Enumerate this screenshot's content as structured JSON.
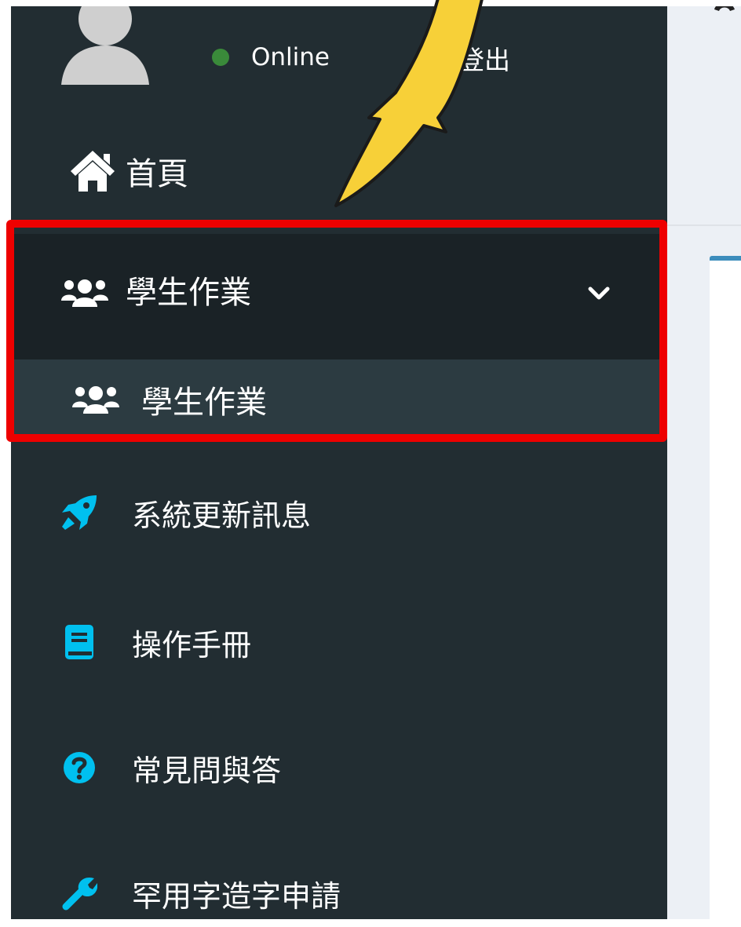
{
  "user": {
    "status": "Online",
    "logout_label": "登出"
  },
  "menu": {
    "home": {
      "label": "首頁",
      "icon": "home-icon"
    },
    "student_work_group": {
      "label": "學生作業",
      "icon": "users-icon",
      "expanded": true
    },
    "student_work_sub": {
      "label": "學生作業",
      "icon": "users-icon"
    },
    "system_updates": {
      "label": "系統更新訊息",
      "icon": "rocket-icon"
    },
    "manual": {
      "label": "操作手冊",
      "icon": "book-icon"
    },
    "faq": {
      "label": "常見問與答",
      "icon": "question-circle-icon"
    },
    "rare_char": {
      "label": "罕用字造字申請",
      "icon": "wrench-icon"
    }
  },
  "colors": {
    "sidebar_bg": "#222d32",
    "active_bg": "#1a2226",
    "submenu_bg": "#2c3b41",
    "accent_cyan": "#00c0ef",
    "online_green": "#3a8a3a",
    "highlight_red": "#ee0000",
    "arrow_yellow": "#f7d038"
  }
}
